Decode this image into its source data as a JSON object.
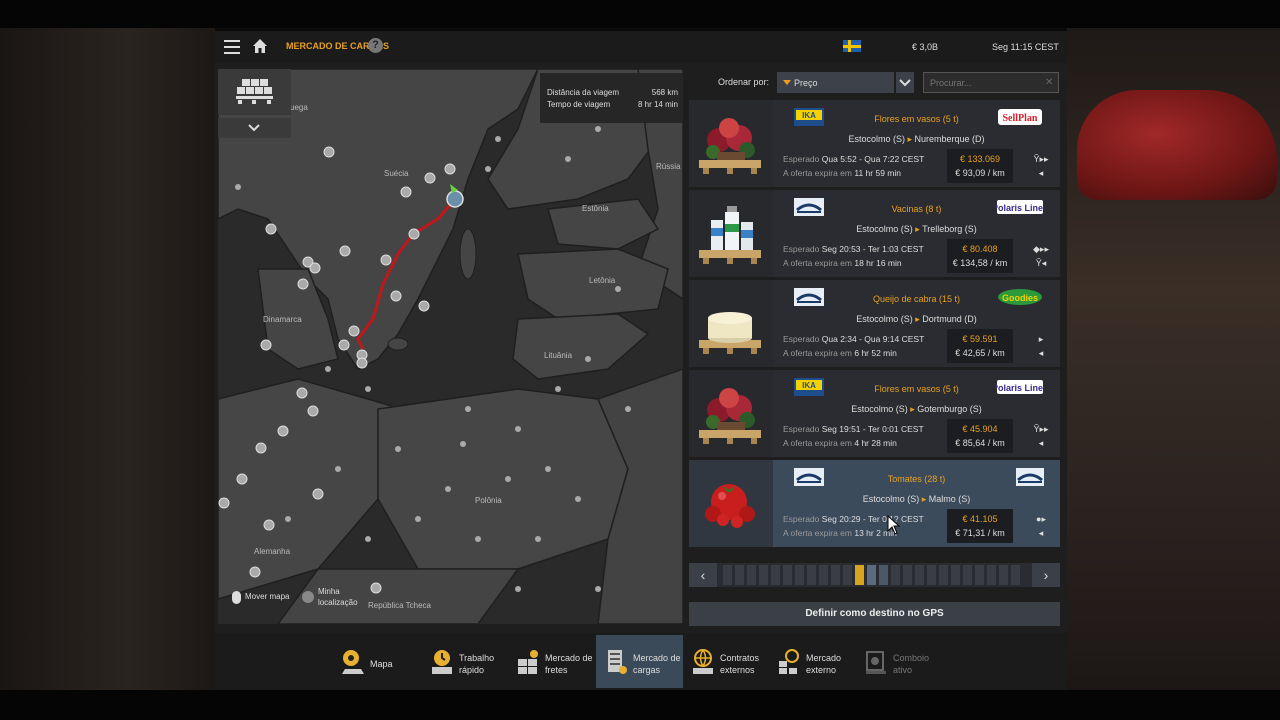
{
  "header": {
    "title": "MERCADO DE CARGAS",
    "money": "€ 3,0B",
    "time": "Seg 11:15 CEST"
  },
  "map": {
    "trip_distance_label": "Distância da viagem",
    "trip_distance_value": "568 km",
    "trip_time_label": "Tempo de viagem",
    "trip_time_value": "8 hr 14 min",
    "labels": {
      "noruega": "uega",
      "suecia": "Suécia",
      "russia": "Rússia",
      "estonia": "Estônia",
      "letonia": "Letônia",
      "dinamarca": "Dinamarca",
      "lituania": "Lituânia",
      "polonia": "Polônia",
      "alemanha": "Alemanha",
      "republica_tcheca": "República Tcheca"
    },
    "move_map_label": "Mover mapa",
    "my_location_line1": "Minha",
    "my_location_line2": "localização"
  },
  "sort": {
    "label": "Ordenar por:",
    "value": "Preço",
    "search_placeholder": "Procurar..."
  },
  "jobs": [
    {
      "cargo": "Flores em vasos (5 t)",
      "from": "Estocolmo (S)",
      "to": "Nuremberque (D)",
      "expected_label": "Esperado",
      "expected": "Qua 5:52 - Qua 7:22 CEST",
      "offer_label": "A oferta expira em",
      "offer": "11 hr 59 min",
      "pay": "€ 133.069",
      "per_km": "€ 93,09 / km",
      "company": "IKA",
      "client": "SellPlan"
    },
    {
      "cargo": "Vacinas (8 t)",
      "from": "Estocolmo (S)",
      "to": "Trelleborg (S)",
      "expected_label": "Esperado",
      "expected": "Seg 20:53 - Ter 1:03 CEST",
      "offer_label": "A oferta expira em",
      "offer": "18 hr 16 min",
      "pay": "€ 80.408",
      "per_km": "€ 134,58 / km",
      "company": "NBFC",
      "client": "Polaris Lines"
    },
    {
      "cargo": "Queijo de cabra (15 t)",
      "from": "Estocolmo (S)",
      "to": "Dortmund (D)",
      "expected_label": "Esperado",
      "expected": "Qua 2:34 - Qua 9:14 CEST",
      "offer_label": "A oferta expira em",
      "offer": "6 hr 52 min",
      "pay": "€ 59.591",
      "per_km": "€ 42,65 / km",
      "company": "NBFC",
      "client": "Euro Goodies"
    },
    {
      "cargo": "Flores em vasos (5 t)",
      "from": "Estocolmo (S)",
      "to": "Gotemburgo (S)",
      "expected_label": "Esperado",
      "expected": "Seg 19:51 - Ter 0:01 CEST",
      "offer_label": "A oferta expira em",
      "offer": "4 hr 28 min",
      "pay": "€ 45.904",
      "per_km": "€ 85,64 / km",
      "company": "IKA",
      "client": "Polaris Lines"
    },
    {
      "cargo": "Tomates (28 t)",
      "from": "Estocolmo (S)",
      "to": "Malmo (S)",
      "expected_label": "Esperado",
      "expected": "Seg 20:29 - Ter 0:1? CEST",
      "offer_label": "A oferta expira em",
      "offer": "13 hr 2 min",
      "pay": "€ 41.105",
      "per_km": "€ 71,31 / km",
      "company": "NBFC",
      "client": "NBFC"
    }
  ],
  "gps_button": "Definir como destino no GPS",
  "tabs": [
    {
      "line1": "Mapa",
      "line2": ""
    },
    {
      "line1": "Trabalho",
      "line2": "rápido"
    },
    {
      "line1": "Mercado de",
      "line2": "fretes"
    },
    {
      "line1": "Mercado de",
      "line2": "cargas"
    },
    {
      "line1": "Contratos",
      "line2": "externos"
    },
    {
      "line1": "Mercado",
      "line2": "externo"
    },
    {
      "line1": "Comboio",
      "line2": "ativo"
    }
  ],
  "colors": {
    "accent": "#e8a020",
    "selected_row": "#3c4b5b",
    "route": "#c0161c"
  }
}
